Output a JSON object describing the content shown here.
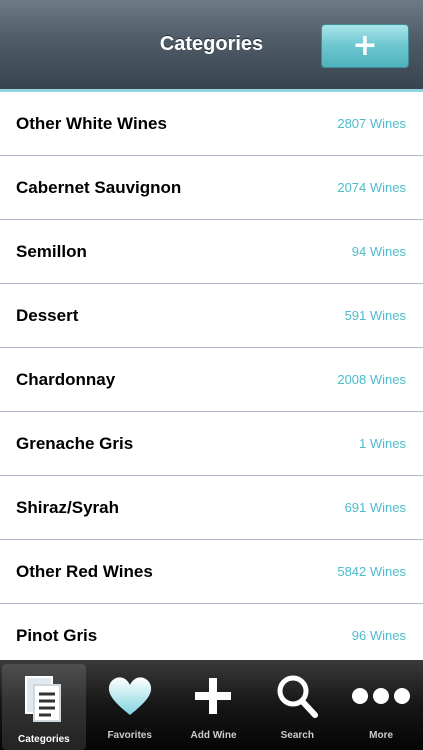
{
  "navbar": {
    "title": "Categories",
    "add_button": "+"
  },
  "categories": [
    {
      "name": "Other White Wines",
      "count": "2807 Wines"
    },
    {
      "name": "Cabernet Sauvignon",
      "count": "2074 Wines"
    },
    {
      "name": "Semillon",
      "count": "94 Wines"
    },
    {
      "name": "Dessert",
      "count": "591 Wines"
    },
    {
      "name": "Chardonnay",
      "count": "2008 Wines"
    },
    {
      "name": "Grenache Gris",
      "count": "1 Wines"
    },
    {
      "name": "Shiraz/Syrah",
      "count": "691 Wines"
    },
    {
      "name": "Other Red Wines",
      "count": "5842 Wines"
    },
    {
      "name": "Pinot Gris",
      "count": "96 Wines"
    }
  ],
  "tabbar": {
    "active": "categories",
    "tabs": [
      {
        "id": "categories",
        "label": "Categories",
        "icon": "documents-icon"
      },
      {
        "id": "favorites",
        "label": "Favorites",
        "icon": "heart-icon"
      },
      {
        "id": "add",
        "label": "Add Wine",
        "icon": "plus-icon"
      },
      {
        "id": "search",
        "label": "Search",
        "icon": "search-icon"
      },
      {
        "id": "more",
        "label": "More",
        "icon": "more-icon"
      }
    ]
  },
  "colors": {
    "accent": "#4bbccb",
    "navbar": "#4f5c67",
    "separator": "#b6b6c8"
  }
}
